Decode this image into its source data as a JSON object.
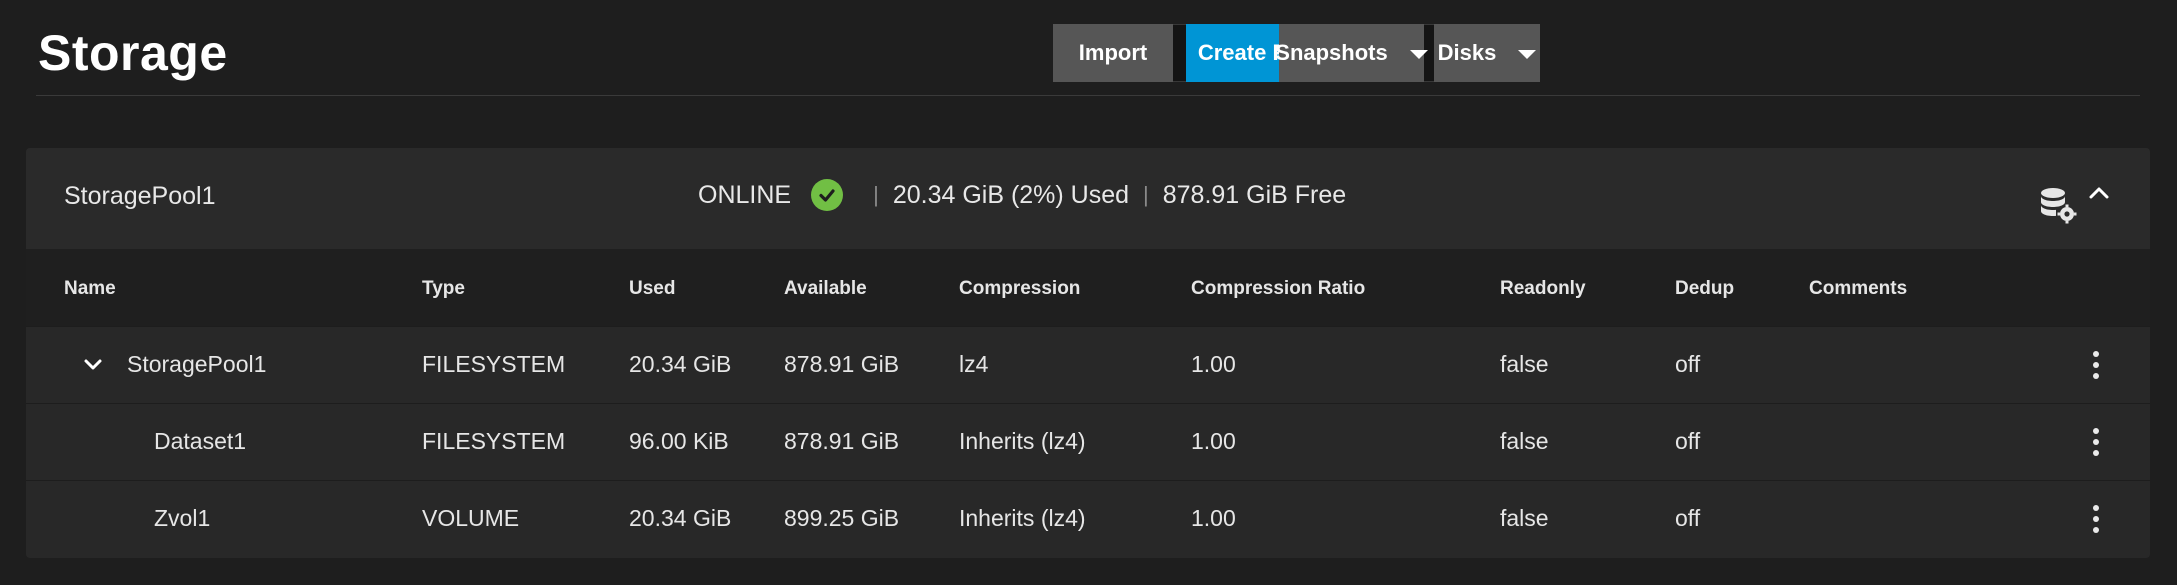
{
  "header": {
    "title": "Storage",
    "search": {
      "value": "",
      "placeholder": "",
      "icon": "search-icon"
    },
    "buttons": {
      "import": "Import",
      "create_pool": "Create Pool",
      "snapshots": "Snapshots",
      "disks": "Disks"
    }
  },
  "colors": {
    "accent": "#0095d5",
    "online": "#71bf44",
    "background": "#1e1e1e",
    "card": "#282828"
  },
  "pool": {
    "name": "StoragePool1",
    "status": "ONLINE",
    "used": "20.34 GiB (2%) Used",
    "free": "878.91 GiB Free",
    "separator": "|",
    "icons": [
      "database-settings-icon",
      "chevron-up-icon",
      "check-circle-icon"
    ]
  },
  "table": {
    "columns": [
      "Name",
      "Type",
      "Used",
      "Available",
      "Compression",
      "Compression Ratio",
      "Readonly",
      "Dedup",
      "Comments"
    ],
    "rows": [
      {
        "name": "StoragePool1",
        "type": "FILESYSTEM",
        "used": "20.34 GiB",
        "available": "878.91 GiB",
        "compression": "lz4",
        "ratio": "1.00",
        "readonly": "false",
        "dedup": "off",
        "comments": ""
      },
      {
        "name": "Dataset1",
        "type": "FILESYSTEM",
        "used": "96.00 KiB",
        "available": "878.91 GiB",
        "compression": "Inherits (lz4)",
        "ratio": "1.00",
        "readonly": "false",
        "dedup": "off",
        "comments": ""
      },
      {
        "name": "Zvol1",
        "type": "VOLUME",
        "used": "20.34 GiB",
        "available": "899.25 GiB",
        "compression": "Inherits (lz4)",
        "ratio": "1.00",
        "readonly": "false",
        "dedup": "off",
        "comments": ""
      }
    ]
  }
}
